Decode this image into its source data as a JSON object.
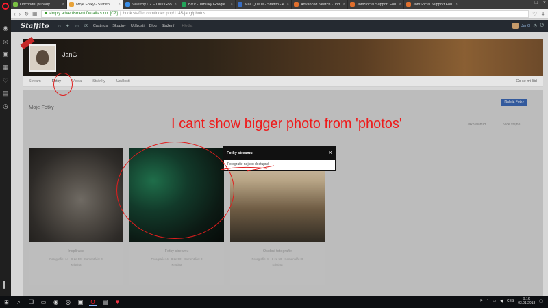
{
  "browser": {
    "tabs": [
      {
        "label": "Obchodní případy",
        "color": "#7ac143"
      },
      {
        "label": "Moje Fotky - Staffito",
        "color": "#e8a33a",
        "active": true
      },
      {
        "label": "Veletrhy CZ – Disk Google",
        "color": "#3a8ee8"
      },
      {
        "label": "BVV - Tabulky Google",
        "color": "#22a55a"
      },
      {
        "label": "Mail Queue - Staffito - Ad",
        "color": "#3a6fc4"
      },
      {
        "label": "Advanced Search - JomSo",
        "color": "#e06f2d"
      },
      {
        "label": "JomSocial Support Forum",
        "color": "#e06f2d"
      },
      {
        "label": "JomSocial Support Forum",
        "color": "#e06f2d"
      }
    ],
    "address": {
      "org": "simply advertisment Details s.r.o. [CZ]",
      "url": "book.staffito.com/index.php/1145-jang/photos"
    }
  },
  "site": {
    "brand": "Staffito",
    "nav": [
      "Castings",
      "Skupiny",
      "Události",
      "Blog",
      "Stažení"
    ],
    "search_placeholder": "Hledat",
    "user_name": "JanG"
  },
  "profile": {
    "name": "JanG",
    "subnav": [
      "Stream",
      "Fotky",
      "Videa",
      "Stránky",
      "Události"
    ],
    "subnav_active": 1,
    "right": "Co se mi líbí"
  },
  "photos": {
    "title": "Moje Fotky",
    "upload_label": "Nahrát Fotky",
    "sort_a": "Jako alabum",
    "sort_b": "Vice stejné",
    "albums": [
      {
        "title": "Insplirace",
        "meta": "Fotografie: 14 · 8 ze 50 · Komentáře: 0",
        "owner": "Kristina"
      },
      {
        "title": "Fotky streamu",
        "meta": "Fotografie: 4 · 8 ze 50 · Komentáře: 0",
        "owner": "Kristina"
      },
      {
        "title": "Osobní fotografie",
        "meta": "Fotografie: 8 · 8 ze 50 · Komentáře: 0",
        "owner": "Kristina"
      }
    ]
  },
  "modal": {
    "title": "Fotky streamu",
    "message": "Fotografie nejsou dostupné",
    "close": "×"
  },
  "annotation": {
    "text": "I cant show bigger photo from 'photos'",
    "color": "#ee1c1c"
  },
  "taskbar": {
    "lang": "CES",
    "time": "9:16",
    "date": "03.01.2018"
  }
}
